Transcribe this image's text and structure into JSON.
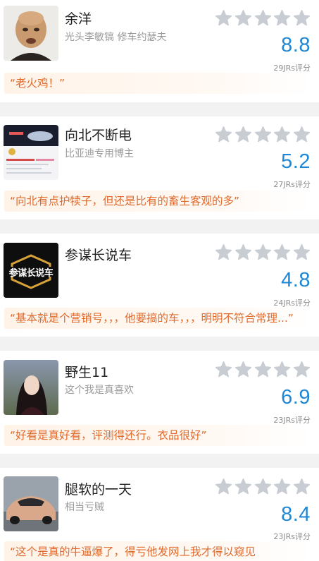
{
  "colors": {
    "accent": "#1e88d6",
    "quote": "#e06a2c",
    "star_empty": "#c8cdd3"
  },
  "reviewers": [
    {
      "name": "余洋",
      "subtitle": "光头李敏镐 修车约瑟夫",
      "score": "8.8",
      "count": "29JRs评分",
      "quote": "“老火鸡！”",
      "avatar": "bald-man-avatar"
    },
    {
      "name": "向北不断电",
      "subtitle": "比亚迪专用博主",
      "score": "5.2",
      "count": "27JRs评分",
      "quote": "“向北有点护犊子，但还是比有的畜生客观的多”",
      "avatar": "video-thumbnail-avatar"
    },
    {
      "name": "参谋长说车",
      "subtitle": "",
      "score": "4.8",
      "count": "24JRs评分",
      "quote": "“基本就是个营销号，，，他要搞的车，，，明明不符合常理...”",
      "avatar": "logo-avatar",
      "logo_text": "参谋长说车"
    },
    {
      "name": "野生11",
      "subtitle": "这个我是真喜欢",
      "score": "6.9",
      "count": "23JRs评分",
      "quote": "“好看是真好看，评测得还行。衣品很好”",
      "avatar": "woman-photo-avatar"
    },
    {
      "name": "腿软的一天",
      "subtitle": "相当亏贼",
      "score": "8.4",
      "count": "23JRs评分",
      "quote": "“这个是真的牛逼爆了，得亏他发网上我才得以窥见",
      "avatar": "sports-car-avatar"
    }
  ]
}
